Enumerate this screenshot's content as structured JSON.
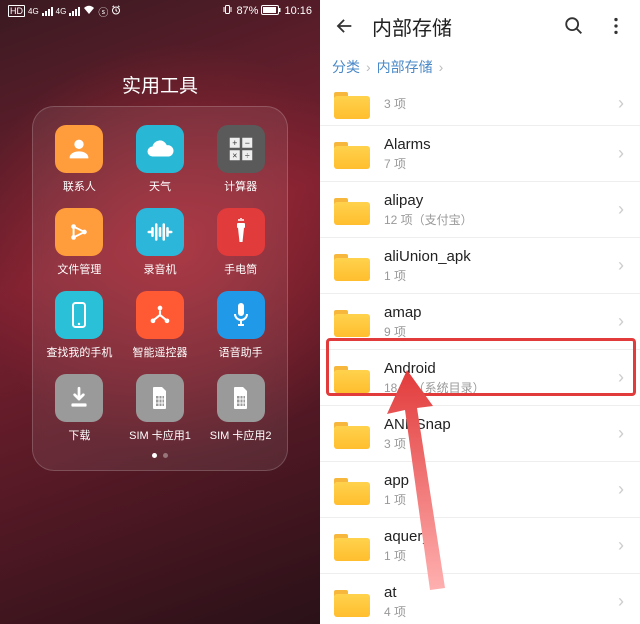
{
  "left": {
    "status": {
      "battery": "87%",
      "time": "10:16"
    },
    "folder_title": "实用工具",
    "apps": [
      {
        "label": "联系人",
        "bg": "#ff9c3c",
        "icon": "contact"
      },
      {
        "label": "天气",
        "bg": "#28b8d6",
        "icon": "cloud"
      },
      {
        "label": "计算器",
        "bg": "#5a5a5a",
        "icon": "calc"
      },
      {
        "label": "文件管理",
        "bg": "#ff9c3c",
        "icon": "files"
      },
      {
        "label": "录音机",
        "bg": "#2bb6da",
        "icon": "wave"
      },
      {
        "label": "手电筒",
        "bg": "#e13b3b",
        "icon": "torch"
      },
      {
        "label": "查找我的手机",
        "bg": "#2ac1d8",
        "icon": "phone"
      },
      {
        "label": "智能遥控器",
        "bg": "#ff5a33",
        "icon": "remote"
      },
      {
        "label": "语音助手",
        "bg": "#2099e8",
        "icon": "mic"
      },
      {
        "label": "下载",
        "bg": "#9a9a9a",
        "icon": "download"
      },
      {
        "label": "SIM 卡应用1",
        "bg": "#9a9a9a",
        "icon": "sim"
      },
      {
        "label": "SIM 卡应用2",
        "bg": "#9a9a9a",
        "icon": "sim"
      }
    ]
  },
  "right": {
    "title": "内部存储",
    "crumbs": [
      "分类",
      "内部存储"
    ],
    "items": [
      {
        "name": "",
        "sub": "3 项",
        "partial": true
      },
      {
        "name": "Alarms",
        "sub": "7 项"
      },
      {
        "name": "alipay",
        "sub": "12 项（支付宝）"
      },
      {
        "name": "aliUnion_apk",
        "sub": "1 项"
      },
      {
        "name": "amap",
        "sub": "9 项"
      },
      {
        "name": "Android",
        "sub": "18 项（系统目录）",
        "highlight": true
      },
      {
        "name": "ANRSnap",
        "sub": "3 项"
      },
      {
        "name": "app",
        "sub": "1 项"
      },
      {
        "name": "aquery",
        "sub": "1 项"
      },
      {
        "name": "at",
        "sub": "4 项"
      }
    ]
  }
}
